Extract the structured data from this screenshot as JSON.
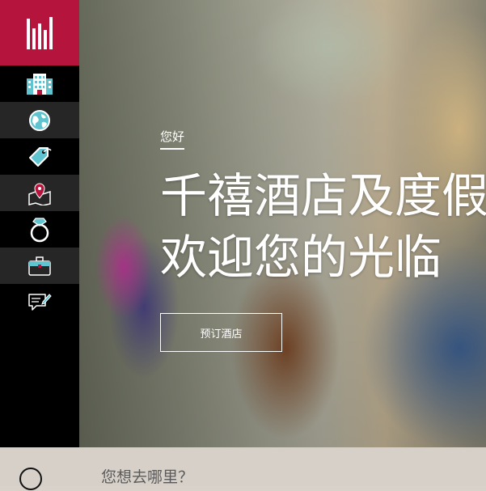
{
  "brand": {
    "logo_icon": "bar-logo-icon",
    "color": "#b5143c"
  },
  "sidebar": {
    "items": [
      {
        "icon": "hotel-building-icon"
      },
      {
        "icon": "globe-icon"
      },
      {
        "icon": "price-tag-icon"
      },
      {
        "icon": "map-pin-icon"
      },
      {
        "icon": "ring-icon"
      },
      {
        "icon": "briefcase-icon"
      },
      {
        "icon": "feedback-icon"
      }
    ]
  },
  "hero": {
    "greeting": "您好",
    "headline_line1": "千禧酒店及度假",
    "headline_line2": "欢迎您的光临",
    "book_button_label": "预订酒店"
  },
  "search": {
    "placeholder": "您想去哪里？",
    "icon": "search-icon"
  }
}
